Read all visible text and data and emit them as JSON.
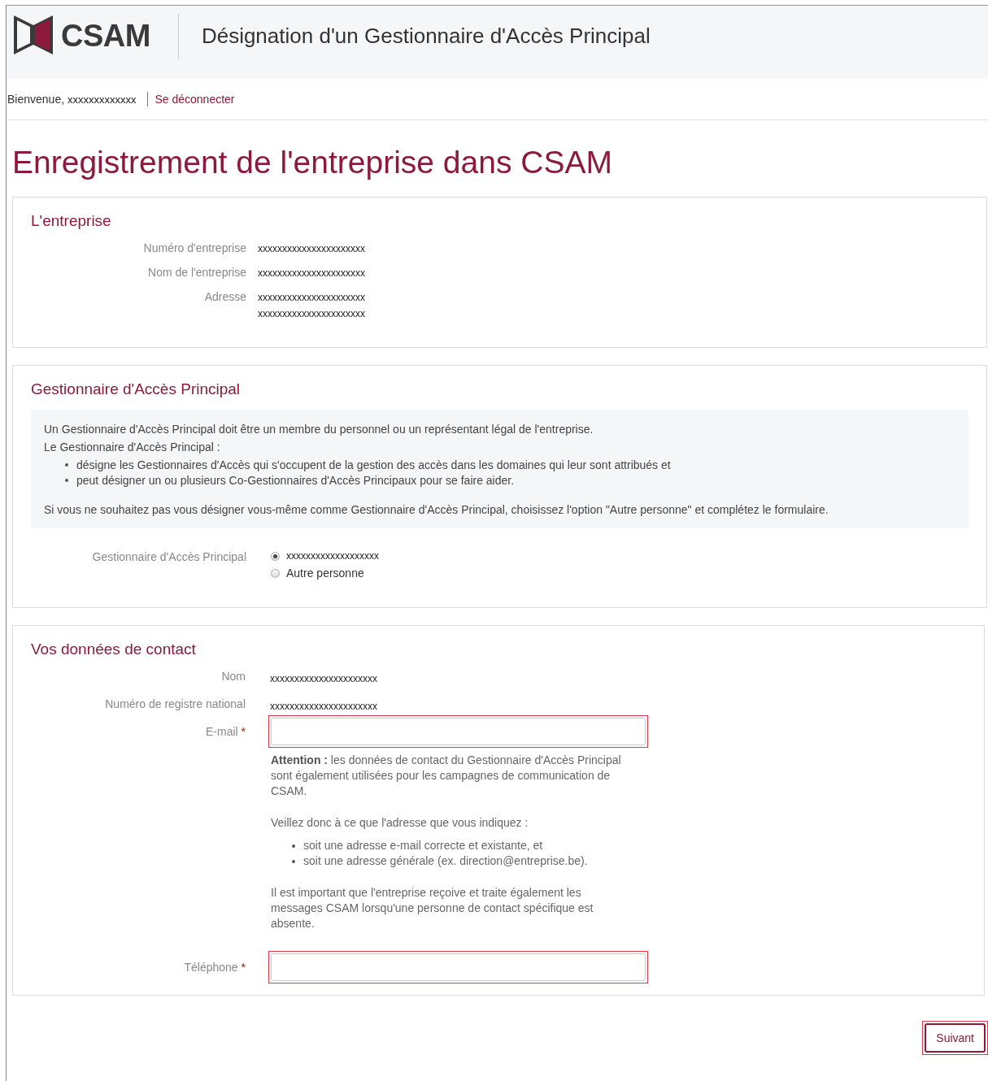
{
  "header": {
    "logo_text": "CSAM",
    "title": "Désignation d'un Gestionnaire d'Accès Principal"
  },
  "user_bar": {
    "welcome": "Bienvenue,",
    "user": "xxxxxxxxxxxxx",
    "logout": "Se déconnecter"
  },
  "page_title": "Enregistrement de l'entreprise dans CSAM",
  "company": {
    "heading": "L'entreprise",
    "fields": [
      {
        "label": "Numéro d'entreprise",
        "lines": [
          "xxxxxxxxxxxxxxxxxxxxxx"
        ]
      },
      {
        "label": "Nom de l'entreprise",
        "lines": [
          "xxxxxxxxxxxxxxxxxxxxxx"
        ]
      },
      {
        "label": "Adresse",
        "lines": [
          "xxxxxxxxxxxxxxxxxxxxxx",
          "xxxxxxxxxxxxxxxxxxxxxx"
        ]
      }
    ]
  },
  "manager": {
    "heading": "Gestionnaire d'Accès Principal",
    "info": {
      "lead": "Un Gestionnaire d'Accès Principal doit être un membre du personnel ou un représentant légal de l'entreprise.",
      "intro": "Le Gestionnaire d'Accès Principal :",
      "bullets": [
        "désigne les Gestionnaires d'Accès qui s'occupent de la gestion des accès dans les domaines qui leur sont attribués et",
        "peut désigner un ou plusieurs Co-Gestionnaires d'Accès Principaux pour se faire aider."
      ],
      "note": "Si vous ne souhaitez pas vous désigner vous-même comme Gestionnaire d'Accès Principal, choisissez l'option \"Autre personne\" et complétez le formulaire."
    },
    "choice_label": "Gestionnaire d'Accès Principal",
    "options": [
      {
        "label": "xxxxxxxxxxxxxxxxxxx",
        "selected": true
      },
      {
        "label": "Autre personne",
        "selected": false
      }
    ]
  },
  "contact": {
    "heading": "Vos données de contact",
    "static_fields": [
      {
        "label": "Nom",
        "value": "xxxxxxxxxxxxxxxxxxxxxx"
      },
      {
        "label": "Numéro de registre national",
        "value": "xxxxxxxxxxxxxxxxxxxxxx"
      }
    ],
    "email": {
      "label": "E-mail",
      "required_mark": "*",
      "highlighted": true
    },
    "email_help": {
      "warning": "**Attention :** les données de contact du Gestionnaire d'Accès Principal sont également utilisées pour les campagnes de communication de CSAM.",
      "intro": "Veillez donc à ce que l'adresse que vous indiquez :",
      "bullets": [
        "soit une adresse e-mail correcte et existante, et",
        "soit une adresse générale (ex. direction@entreprise.be)."
      ],
      "closing": "Il est important que l'entreprise reçoive et traite également les messages CSAM lorsqu'une personne de contact spécifique est absente."
    },
    "phone": {
      "label": "Téléphone",
      "required_mark": "*",
      "highlighted": true
    }
  },
  "next_button": {
    "label": "Suivant",
    "highlighted": true
  }
}
